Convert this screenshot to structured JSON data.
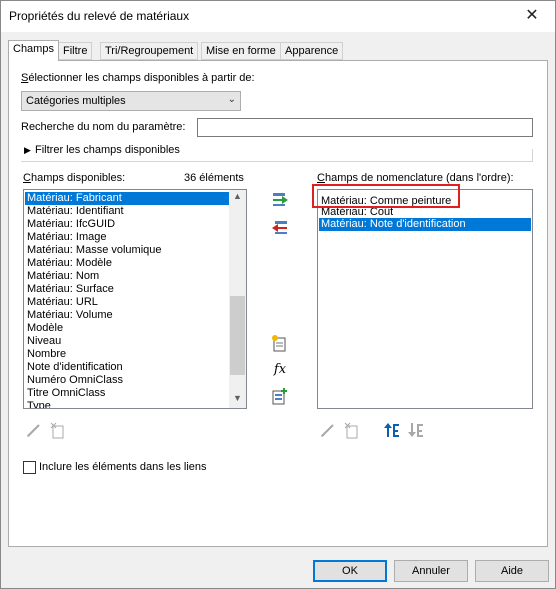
{
  "window": {
    "title": "Propriétés du relevé de matériaux",
    "close_glyph": "✕"
  },
  "tabs": [
    {
      "label": "Champs",
      "active": true
    },
    {
      "label": "Filtre",
      "active": false
    },
    {
      "label": "Tri/Regroupement",
      "active": false
    },
    {
      "label": "Mise en forme",
      "active": false
    },
    {
      "label": "Apparence",
      "active": false
    }
  ],
  "source": {
    "label_prefix": "S",
    "label_rest": "électionner les champs disponibles à partir de:",
    "combo_value": "Catégories multiples"
  },
  "param_search": {
    "label": "Recherche du nom du paramètre:",
    "value": ""
  },
  "filter_toggle": {
    "label": "Filtrer les champs disponibles"
  },
  "available": {
    "label_prefix": "C",
    "label_rest": "hamps disponibles:",
    "count": "36 éléments",
    "items": [
      "Matériau: Fabricant",
      "Matériau: Identifiant",
      "Matériau: IfcGUID",
      "Matériau: Image",
      "Matériau: Masse volumique",
      "Matériau: Modèle",
      "Matériau: Nom",
      "Matériau: Surface",
      "Matériau: URL",
      "Matériau: Volume",
      "Modèle",
      "Niveau",
      "Nombre",
      "Note d'identification",
      "Numéro OmniClass",
      "Titre OmniClass",
      "Type"
    ],
    "selected_index": 0
  },
  "schedule": {
    "label_prefix": "C",
    "label_rest": "hamps de nomenclature (dans l'ordre):",
    "items": [
      "Matériau: Comme peinture",
      "Matériau: Coût",
      "Matériau: Note d'identification"
    ],
    "selected_index": 2
  },
  "icons": {
    "add": "add-field-icon",
    "remove": "remove-field-icon",
    "new_param": "new-parameter-icon",
    "calc_value": "calculated-value-icon",
    "combine": "combine-parameters-icon",
    "edit": "edit-icon",
    "delete": "delete-icon",
    "move_up": "move-up-icon",
    "move_down": "move-down-icon",
    "fx_text": "fx"
  },
  "include_links": {
    "label": "Inclure les éléments dans les liens",
    "checked": false
  },
  "buttons": {
    "ok": "OK",
    "cancel": "Annuler",
    "help": "Aide"
  },
  "colors": {
    "selection": "#0078d7",
    "highlight": "#e02020"
  }
}
